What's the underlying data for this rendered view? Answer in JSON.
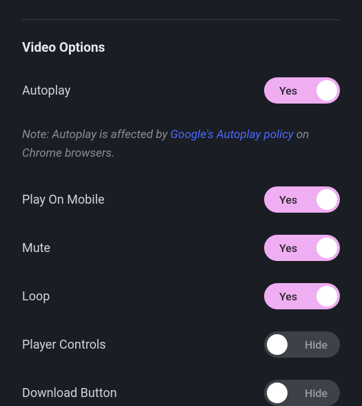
{
  "section_title": "Video Options",
  "note": {
    "prefix": "Note: Autoplay is affected by ",
    "link_text": "Google's Autoplay policy",
    "suffix": " on Chrome browsers."
  },
  "toggle_labels": {
    "on": "Yes",
    "off": "Hide"
  },
  "options": {
    "autoplay": {
      "label": "Autoplay",
      "state": "on"
    },
    "play_on_mobile": {
      "label": "Play On Mobile",
      "state": "on"
    },
    "mute": {
      "label": "Mute",
      "state": "on"
    },
    "loop": {
      "label": "Loop",
      "state": "on"
    },
    "player_controls": {
      "label": "Player Controls",
      "state": "off"
    },
    "download_button": {
      "label": "Download Button",
      "state": "off"
    }
  }
}
